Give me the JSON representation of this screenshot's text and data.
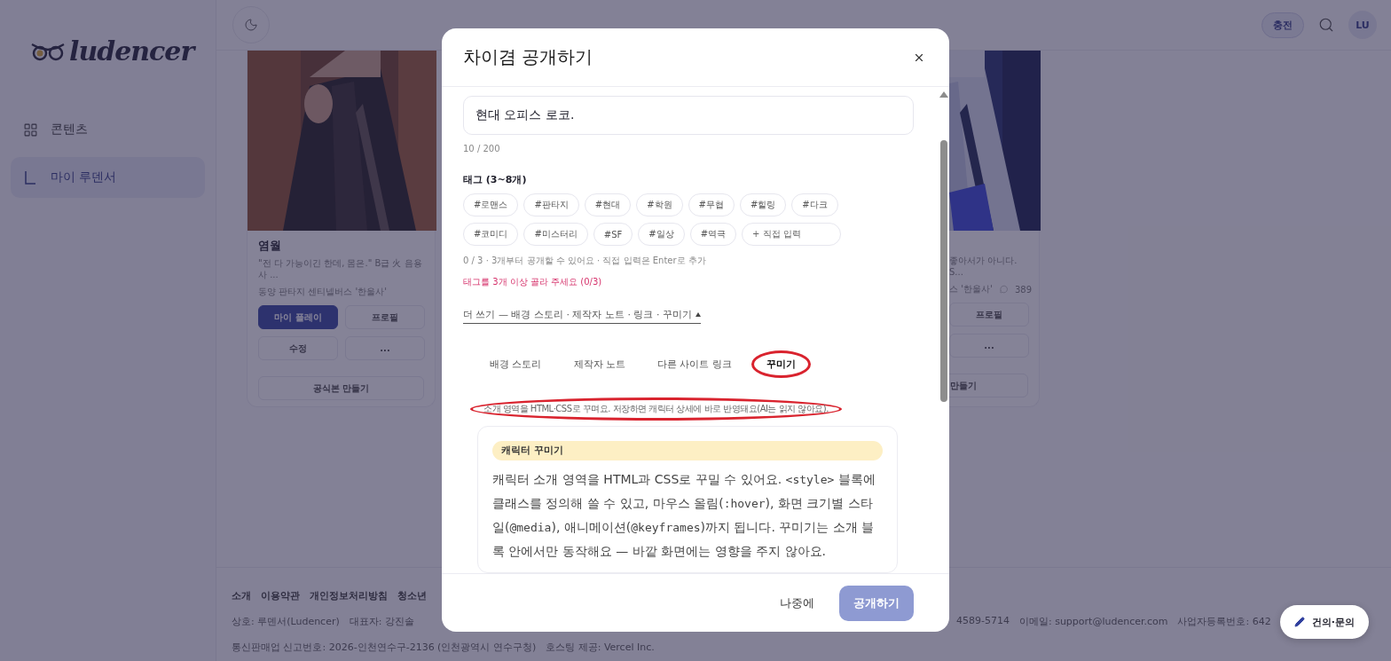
{
  "sidebar": {
    "logo": "ludencer",
    "items": [
      {
        "label": "콘텐츠",
        "selected": false
      },
      {
        "label": "마이 루덴서",
        "selected": true
      }
    ]
  },
  "header": {
    "charge": "충전",
    "avatar": "LU"
  },
  "cards": [
    {
      "title": "염월",
      "description": "\"전 다 가능이긴 한데, 몸은.\" B급 火 음용사 ...",
      "meta": "동양 판타지 센티넬버스 '한울사'",
      "primary": "마이 플레이",
      "profile": "프로필",
      "edit": "수정",
      "more": "...",
      "official": "공식본 만들기"
    },
    {
      "description": "좋아서가 아니다. S...",
      "meta": "스 '한울사'",
      "count": "389",
      "profile": "프로필",
      "more": "...",
      "official": "만들기"
    }
  ],
  "footer": {
    "links": [
      "소개",
      "이용약관",
      "개인정보처리방침",
      "청소년"
    ],
    "info_left": [
      "상호: 루덴서(Ludencer)",
      "대표자: 강진솔"
    ],
    "info_right": [
      "4589-5714",
      "이메일: support@ludencer.com",
      "사업자등록번호: 642"
    ],
    "info_line3": [
      "통신판매업 신고번호: 2026-인천연수구-2136 (인천광역시 연수구청)",
      "호스팅 제공: Vercel Inc."
    ]
  },
  "feedback_button": "건의·문의",
  "dialog": {
    "title": "차이겸 공개하기",
    "summary_value": "현대 오피스 로코.",
    "summary_count": "10 / 200",
    "tags_label": "태그 (3~8개)",
    "tags": [
      {
        "label": "#로맨스",
        "selected": false
      },
      {
        "label": "#판타지",
        "selected": false
      },
      {
        "label": "#현대",
        "selected": false
      },
      {
        "label": "#학원",
        "selected": false
      },
      {
        "label": "#무협",
        "selected": false
      },
      {
        "label": "#힐링",
        "selected": false
      },
      {
        "label": "#다크",
        "selected": false
      },
      {
        "label": "#코미디",
        "selected": false
      },
      {
        "label": "#미스터리",
        "selected": false
      },
      {
        "label": "#SF",
        "selected": false
      },
      {
        "label": "#일상",
        "selected": false
      },
      {
        "label": "#역극",
        "selected": false
      }
    ],
    "tag_input_placeholder": "+ 직접 입력",
    "tags_hint": "0 / 3 · 3개부터 공개할 수 있어요 · 직접 입력은 Enter로 추가",
    "tags_error": "태그를 3개 이상 골라 주세요 (0/3)",
    "more_toggle": "더 쓰기 — 배경 스토리 · 제작자 노트 · 링크 · 꾸미기",
    "expanded": true,
    "tabs": [
      {
        "label": "배경 스토리",
        "selected": false,
        "circled": false
      },
      {
        "label": "제작자 노트",
        "selected": false,
        "circled": false
      },
      {
        "label": "다른 사이트 링크",
        "selected": false,
        "circled": false
      },
      {
        "label": "꾸미기",
        "selected": true,
        "circled": true
      }
    ],
    "tab_description": {
      "text": "소개 영역을 HTML·CSS로 꾸며요. 저장하면 캐릭터 상세에 바로 반영돼요(AI는 읽지 않아요).",
      "circled": true
    },
    "info_card": {
      "badge": "캐릭터 꾸미기",
      "paragraph": [
        {
          "text": "캐릭터 소개 영역을 HTML과 CSS로 꾸밀 수 있어요. ",
          "code": false
        },
        {
          "text": "<style>",
          "code": true
        },
        {
          "text": " 블록에 클래스를 정의해 쓸 수 있고, 마우스 올림(",
          "code": false
        },
        {
          "text": ":hover",
          "code": true
        },
        {
          "text": "), 화면 크기별 스타일(",
          "code": false
        },
        {
          "text": "@media",
          "code": true
        },
        {
          "text": "), 애니메이션(",
          "code": false
        },
        {
          "text": "@keyframes",
          "code": true
        },
        {
          "text": ")까지 됩니다. 꾸미기는 소개 블록 안에서만 동작해요 — 바깥 화면에는 영향을 주지 않아요.",
          "code": false
        }
      ]
    },
    "later_button": "나중에",
    "publish_button": {
      "label": "공개하기",
      "disabled": true
    }
  }
}
